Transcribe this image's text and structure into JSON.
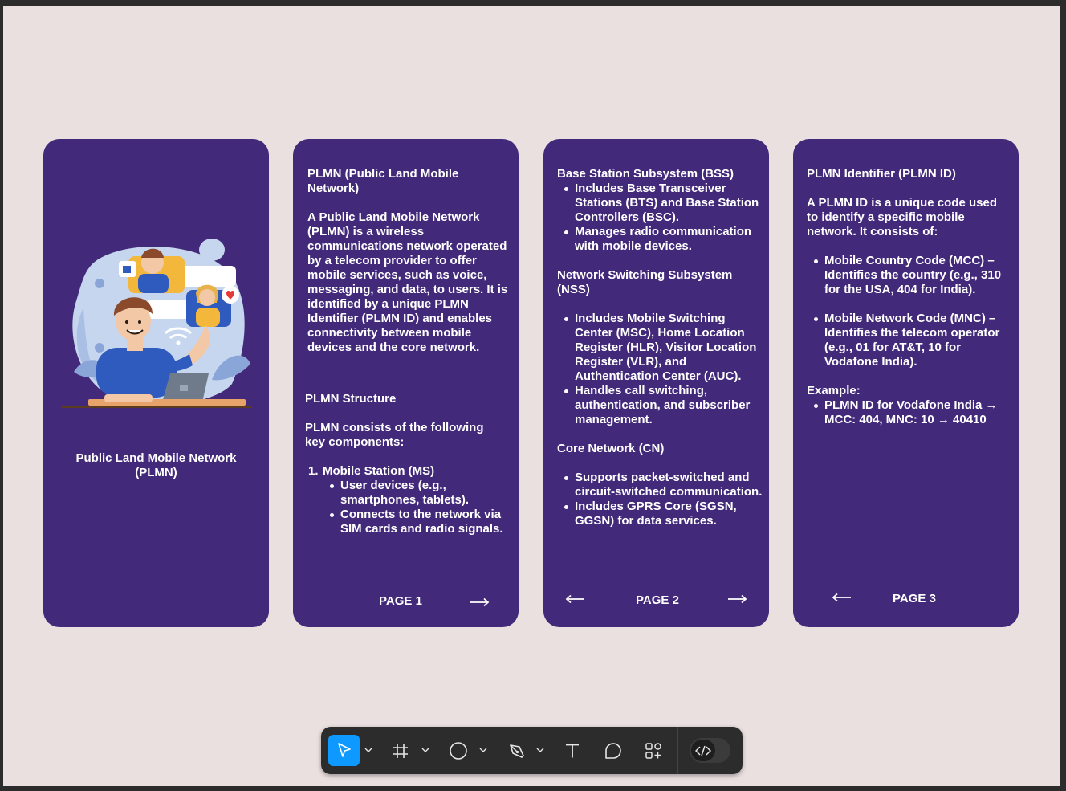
{
  "cards": [
    {
      "title": "Public Land Mobile Network (PLMN)"
    },
    {
      "heading": "PLMN (Public Land Mobile Network)",
      "intro": "A Public Land Mobile Network (PLMN) is a wireless communications network operated by a telecom provider to offer mobile services, such as voice, messaging, and data, to users. It is identified by a unique PLMN Identifier (PLMN ID) and enables connectivity between mobile devices and the core network.",
      "structure_heading": "PLMN Structure",
      "structure_intro": "PLMN consists of the following key components:",
      "item1_number": "1.",
      "item1_title": "Mobile Station (MS)",
      "item1_bullets": [
        "User devices (e.g., smartphones, tablets).",
        "Connects to the network via SIM cards and radio signals."
      ],
      "page_label": "PAGE 1"
    },
    {
      "bss_heading": "Base Station Subsystem (BSS)",
      "bss_bullets": [
        "Includes Base Transceiver Stations (BTS) and Base Station Controllers (BSC).",
        "Manages radio communication with mobile devices."
      ],
      "nss_heading": "Network Switching Subsystem (NSS)",
      "nss_bullets": [
        "Includes Mobile Switching Center (MSC), Home Location Register (HLR), Visitor Location Register (VLR), and Authentication Center (AUC).",
        "Handles call switching, authentication, and subscriber management."
      ],
      "cn_heading": "Core Network (CN)",
      "cn_bullets": [
        "Supports packet-switched and circuit-switched communication.",
        "Includes GPRS Core (SGSN, GGSN) for data services."
      ],
      "page_label": "PAGE 2"
    },
    {
      "heading": "PLMN Identifier (PLMN ID)",
      "intro": "A PLMN ID is a unique code used to identify a specific mobile network. It consists of:",
      "bullet1": "Mobile Country Code (MCC) – Identifies the country (e.g., 310 for the USA, 404 for India).",
      "bullet2": "Mobile Network Code (MNC) – Identifies the telecom operator (e.g., 01 for AT&T, 10 for Vodafone India).",
      "example_label": "Example:",
      "example_bullet": "PLMN ID for Vodafone India → MCC: 404, MNC: 10 → 40410",
      "page_label": "PAGE 3"
    }
  ],
  "toolbar": {
    "tools": [
      "move-tool",
      "frame-tool",
      "shape-tool",
      "pen-tool",
      "text-tool",
      "comment-tool",
      "actions-tool",
      "dev-mode-toggle"
    ],
    "active_tool": "move-tool",
    "accent_color": "#0d99ff"
  },
  "colors": {
    "card": "#42297a",
    "canvas": "#ebe0e0",
    "chrome": "#2c2c2c"
  }
}
